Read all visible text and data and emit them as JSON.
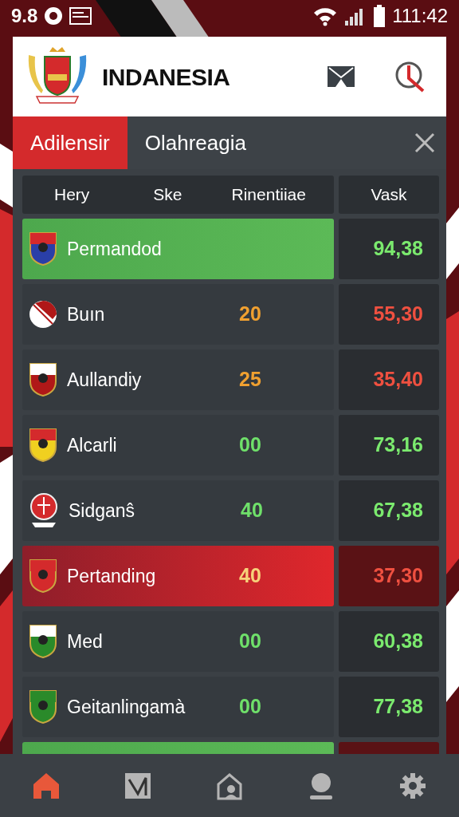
{
  "status_bar": {
    "left_text": "9.8",
    "time": "111:42"
  },
  "header": {
    "title": "INDANESIA"
  },
  "tabs": [
    {
      "label": "Adilensir",
      "selected": true
    },
    {
      "label": "Olahreagia",
      "selected": false
    }
  ],
  "table": {
    "columns": [
      "Hery",
      "Ske",
      "Rinentiiae",
      "Vask"
    ],
    "rows": [
      {
        "kind": "leader",
        "name": "Permandod",
        "value": {
          "text": "94,38",
          "color": "#7bea6e"
        }
      },
      {
        "kind": "plain",
        "name": "Buın",
        "score": {
          "text": "20",
          "color": "#f0a030"
        },
        "value": {
          "text": "55,30",
          "color": "#ef5040"
        }
      },
      {
        "kind": "plain",
        "name": "Aullandiy",
        "score": {
          "text": "25",
          "color": "#f0a030"
        },
        "value": {
          "text": "35,40",
          "color": "#ef5040"
        }
      },
      {
        "kind": "plain",
        "name": "Alcarli",
        "score": {
          "text": "00",
          "color": "#6fe06a"
        },
        "value": {
          "text": "73,16",
          "color": "#7bea6e"
        }
      },
      {
        "kind": "plain",
        "name": "Sidganŝ",
        "score": {
          "text": "40",
          "color": "#6fe06a"
        },
        "value": {
          "text": "67,38",
          "color": "#7bea6e"
        }
      },
      {
        "kind": "danger",
        "name": "Pertanding",
        "score": {
          "text": "40",
          "color": "#f6d27a"
        },
        "value": {
          "text": "37,30",
          "color": "#ef5040"
        }
      },
      {
        "kind": "plain",
        "name": "Med",
        "score": {
          "text": "00",
          "color": "#6fe06a"
        },
        "value": {
          "text": "60,38",
          "color": "#7bea6e"
        }
      },
      {
        "kind": "plain",
        "name": "Geitanlingamà",
        "score": {
          "text": "00",
          "color": "#6fe06a"
        },
        "value": {
          "text": "77,38",
          "color": "#7bea6e"
        }
      },
      {
        "kind": "partial"
      }
    ]
  },
  "bottom_nav": [
    {
      "selected": true
    },
    {
      "selected": false
    },
    {
      "selected": false
    },
    {
      "selected": false
    },
    {
      "selected": false
    }
  ]
}
